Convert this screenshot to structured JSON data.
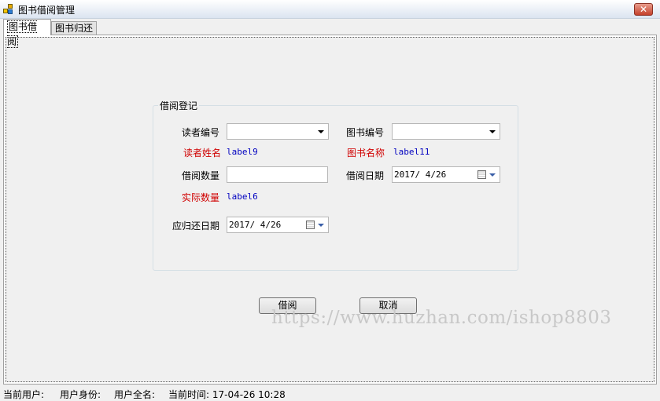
{
  "window": {
    "title": "图书借阅管理",
    "close_label": "✕"
  },
  "tabs": [
    {
      "label": "图书借阅",
      "active": true
    },
    {
      "label": "图书归还",
      "active": false
    }
  ],
  "group": {
    "title": "借阅登记",
    "reader_id": {
      "label": "读者编号",
      "value": ""
    },
    "book_id": {
      "label": "图书编号",
      "value": ""
    },
    "reader_name": {
      "label": "读者姓名",
      "value": "label9"
    },
    "book_name": {
      "label": "图书名称",
      "value": "label11"
    },
    "borrow_count": {
      "label": "借阅数量",
      "value": ""
    },
    "borrow_date": {
      "label": "借阅日期",
      "value": "2017/ 4/26"
    },
    "actual_count": {
      "label": "实际数量",
      "value": "label6"
    },
    "due_date": {
      "label": "应归还日期",
      "value": "2017/ 4/26"
    }
  },
  "buttons": {
    "borrow": "借阅",
    "cancel": "取消"
  },
  "watermark": "https://www.huzhan.com/ishop8803",
  "statusbar": {
    "current_user": "当前用户:",
    "user_role": "用户身份:",
    "user_fullname": "用户全名:",
    "current_time": "当前时间: 17-04-26 10:28"
  },
  "colors": {
    "required_label": "#d00000",
    "value_label": "#0000c0"
  }
}
